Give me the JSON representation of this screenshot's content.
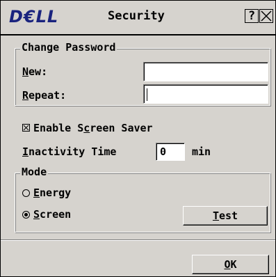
{
  "window": {
    "logo": "D€LL",
    "title": "Security",
    "help_label": "?"
  },
  "change_password": {
    "legend": "Change Password",
    "new_label": "New:",
    "new_value": "",
    "repeat_label": "Repeat:",
    "repeat_value": ""
  },
  "screen_saver": {
    "enable_label": "Enable Screen Saver",
    "enable_checked": true,
    "inactivity_label": "Inactivity Time",
    "inactivity_value": "0",
    "inactivity_unit": "min"
  },
  "mode": {
    "legend": "Mode",
    "options": [
      {
        "label": "Energy",
        "selected": false
      },
      {
        "label": "Screen",
        "selected": true
      }
    ],
    "test_label": "Test"
  },
  "footer": {
    "ok_label": "OK"
  }
}
